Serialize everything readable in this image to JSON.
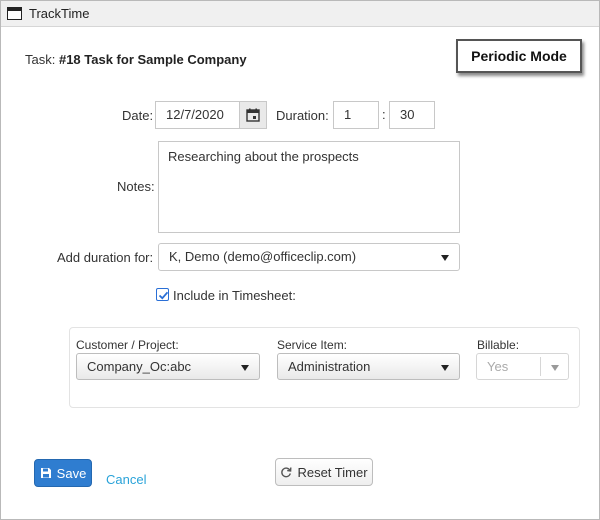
{
  "window": {
    "title": "TrackTime"
  },
  "task": {
    "label": "Task:",
    "value": "#18 Task for Sample Company"
  },
  "mode_badge": "Periodic Mode",
  "date": {
    "label": "Date:",
    "value": "12/7/2020"
  },
  "duration": {
    "label": "Duration:",
    "hours": "1",
    "separator": ":",
    "minutes": "30"
  },
  "notes": {
    "label": "Notes:",
    "value": "Researching about the prospects"
  },
  "add_duration": {
    "label": "Add duration for:",
    "selected": "K, Demo (demo@officeclip.com)"
  },
  "include_timesheet": {
    "label": "Include in Timesheet:",
    "checked": true
  },
  "panel": {
    "customer": {
      "label": "Customer / Project:",
      "selected": "Company_Oc:abc"
    },
    "service": {
      "label": "Service Item:",
      "selected": "Administration"
    },
    "billable": {
      "label": "Billable:",
      "selected": "Yes",
      "disabled": true
    }
  },
  "actions": {
    "save": "Save",
    "cancel": "Cancel",
    "reset": "Reset Timer"
  },
  "colors": {
    "primary": "#2f7dd0",
    "link": "#2aa3d9",
    "checkbox": "#2a6fd6"
  },
  "icons": [
    "window-icon",
    "calendar-icon",
    "checkmark-icon",
    "save-icon",
    "refresh-icon",
    "chevron-down-icon"
  ]
}
